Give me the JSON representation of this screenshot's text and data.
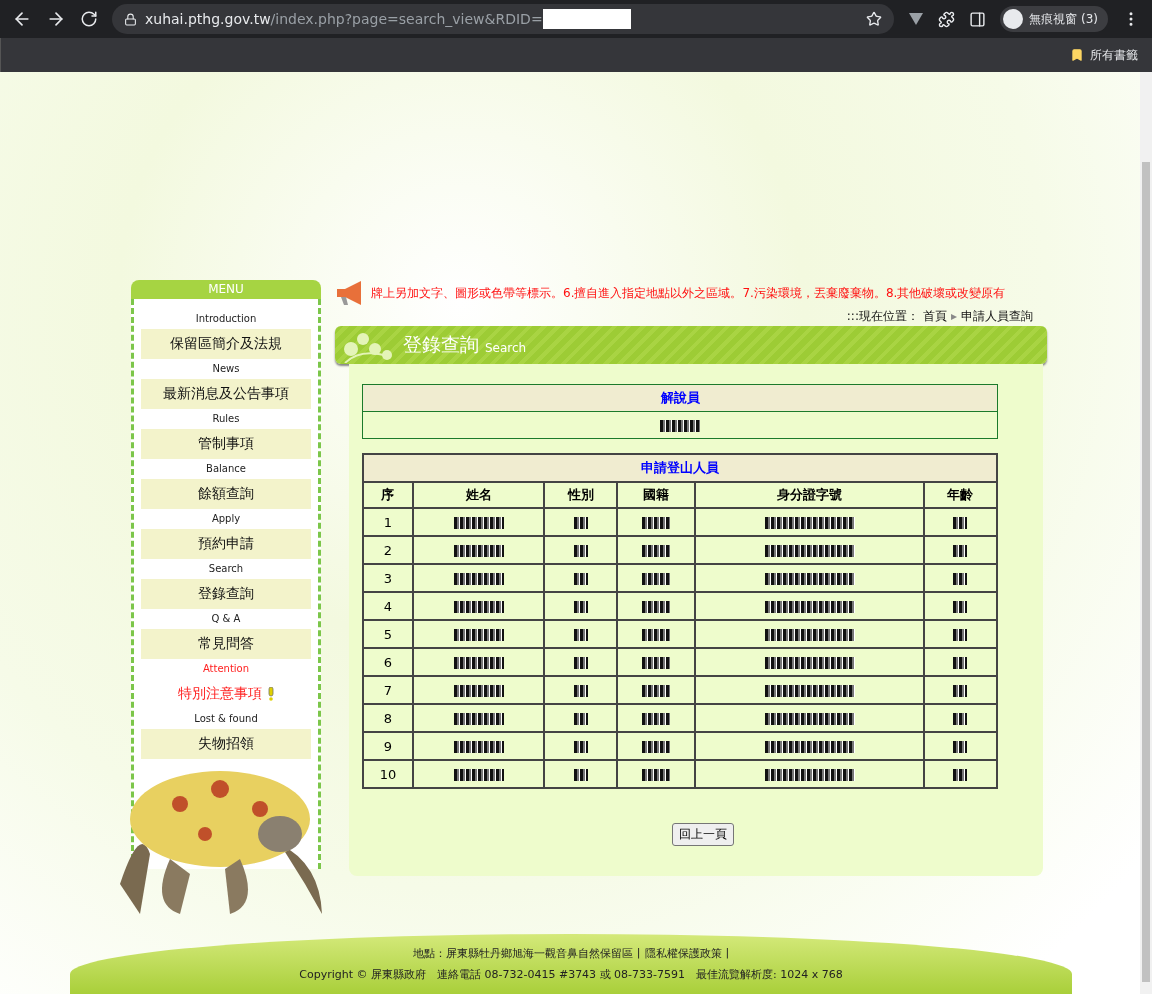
{
  "browser": {
    "url_host": "xuhai.pthg.gov.tw",
    "url_path": "/index.php?page=search_view&RDID=",
    "profile": "無痕視窗 (3)",
    "bookmarks": "所有書籤"
  },
  "menu": {
    "title": "MENU",
    "items": [
      {
        "en": "Introduction",
        "zh": "保留區簡介及法規",
        "alert": false
      },
      {
        "en": "News",
        "zh": "最新消息及公告事項",
        "alert": false
      },
      {
        "en": "Rules",
        "zh": "管制事項",
        "alert": false
      },
      {
        "en": "Balance",
        "zh": "餘額查詢",
        "alert": false
      },
      {
        "en": "Apply",
        "zh": "預約申請",
        "alert": false
      },
      {
        "en": "Search",
        "zh": "登錄查詢",
        "alert": false
      },
      {
        "en": "Q & A",
        "zh": "常見問答",
        "alert": false
      },
      {
        "en": "Attention",
        "zh": "特別注意事項",
        "alert": true
      },
      {
        "en": "Lost & found",
        "zh": "失物招領",
        "alert": false
      }
    ]
  },
  "ticker": "牌上另加文字、圖形或色帶等標示。6.擅自進入指定地點以外之區域。7.污染環境，丟棄廢棄物。8.其他破壞或改變原有",
  "breadcrumb": {
    "label": ":::現在位置：",
    "home": "首頁",
    "separator": "▸",
    "current": "申請人員查詢"
  },
  "heading": {
    "title": "登錄查詢",
    "subtitle": "Search"
  },
  "guide_table": {
    "title": "解說員"
  },
  "members_table": {
    "title": "申請登山人員",
    "columns": [
      "序",
      "姓名",
      "性別",
      "國籍",
      "身分證字號",
      "年齡"
    ],
    "rows": [
      {
        "no": "1"
      },
      {
        "no": "2"
      },
      {
        "no": "3"
      },
      {
        "no": "4"
      },
      {
        "no": "5"
      },
      {
        "no": "6"
      },
      {
        "no": "7"
      },
      {
        "no": "8"
      },
      {
        "no": "9"
      },
      {
        "no": "10"
      }
    ]
  },
  "back_button": "回上一頁",
  "footer": {
    "address": "地點：屏東縣牡丹鄉旭海一觀音鼻自然保留區",
    "separator": "|",
    "privacy": "隱私權保護政策",
    "end_separator": "|",
    "copyright": "Copyright © 屏東縣政府　連絡電話 08-732-0415 #3743 或 08-733-7591　最佳流覽解析度: 1024 x 768"
  }
}
